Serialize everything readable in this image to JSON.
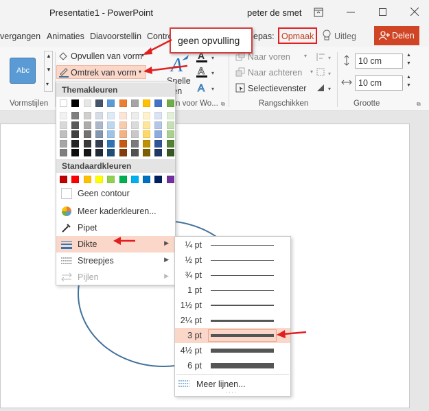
{
  "titlebar": {
    "title": "Presentatie1 - PowerPoint",
    "user": "peter de smet",
    "icons": [
      "ribbon-display-icon",
      "minimize-icon",
      "maximize-icon",
      "close-icon"
    ]
  },
  "tabs": {
    "overgangen": "vergangen",
    "animaties": "Animaties",
    "diavoorstelling": "Diavoorstellin",
    "controle": "Contro",
    "aanpassen": "epas:",
    "opmaak": "Opmaak",
    "uitleg": "Uitleg",
    "delen": "Delen"
  },
  "ribbon": {
    "stijl_sample": "Abc",
    "opvullen": "Opvullen van vorm",
    "omtrek": "Omtrek van vorm",
    "snelle": "Snelle",
    "stijlen": "ijlen",
    "naar_voren": "Naar voren",
    "naar_achteren": "Naar achteren",
    "selectievenster": "Selectievenster",
    "hoogte": "10 cm",
    "breedte": "10 cm",
    "groups": {
      "vormstijlen": "Vormstijlen",
      "wordart": "n voor Wo...",
      "rangschikken": "Rangschikken",
      "grootte": "Grootte"
    }
  },
  "callout": {
    "text": "geen opvulling"
  },
  "menu": {
    "themakleuren": "Themakleuren",
    "standaardkleuren": "Standaardkleuren",
    "geen_contour": "Geen contour",
    "meer_kleuren": "Meer kaderkleuren...",
    "pipet": "Pipet",
    "dikte": "Dikte",
    "streepjes": "Streepjes",
    "pijlen": "Pijlen",
    "theme_colors": [
      "#ffffff",
      "#000000",
      "#e7e6e6",
      "#44546a",
      "#5b9bd5",
      "#ed7d31",
      "#a5a5a5",
      "#ffc000",
      "#4472c4",
      "#70ad47"
    ],
    "theme_shades": [
      [
        "#f2f2f2",
        "#d9d9d9",
        "#bfbfbf",
        "#a6a6a6",
        "#7f7f7f"
      ],
      [
        "#7f7f7f",
        "#595959",
        "#404040",
        "#262626",
        "#0d0d0d"
      ],
      [
        "#d0cece",
        "#aeabab",
        "#757171",
        "#3a3838",
        "#171616"
      ],
      [
        "#d6dce5",
        "#adb9ca",
        "#8497b0",
        "#333f50",
        "#222a35"
      ],
      [
        "#deebf7",
        "#bdd7ee",
        "#9dc3e6",
        "#2e75b6",
        "#1f4e79"
      ],
      [
        "#fbe5d6",
        "#f8cbad",
        "#f4b183",
        "#c55a11",
        "#843c0c"
      ],
      [
        "#ededed",
        "#dbdbdb",
        "#c9c9c9",
        "#7b7b7b",
        "#525252"
      ],
      [
        "#fff2cc",
        "#ffe699",
        "#ffd966",
        "#bf9000",
        "#7f6000"
      ],
      [
        "#dae3f3",
        "#b4c7e7",
        "#8faadc",
        "#2f5597",
        "#203864"
      ],
      [
        "#e2f0d9",
        "#c5e0b4",
        "#a9d18e",
        "#548235",
        "#385723"
      ]
    ],
    "standard_colors": [
      "#c00000",
      "#ff0000",
      "#ffc000",
      "#ffff00",
      "#92d050",
      "#00b050",
      "#00b0f0",
      "#0070c0",
      "#002060",
      "#7030a0"
    ]
  },
  "submenu": {
    "weights": [
      {
        "label": "¼ pt",
        "value": 0.25
      },
      {
        "label": "½ pt",
        "value": 0.5
      },
      {
        "label": "¾ pt",
        "value": 0.75
      },
      {
        "label": "1 pt",
        "value": 1
      },
      {
        "label": "1½ pt",
        "value": 1.5
      },
      {
        "label": "2¼ pt",
        "value": 2.25
      },
      {
        "label": "3 pt",
        "value": 3
      },
      {
        "label": "4½ pt",
        "value": 4.5
      },
      {
        "label": "6 pt",
        "value": 6
      }
    ],
    "selected": "3 pt",
    "meer_lijnen": "Meer lijnen..."
  },
  "colors": {
    "accent": "#c43e1c",
    "highlight": "#fad7c9",
    "circle": "#41719c",
    "arrow": "#e02020"
  }
}
